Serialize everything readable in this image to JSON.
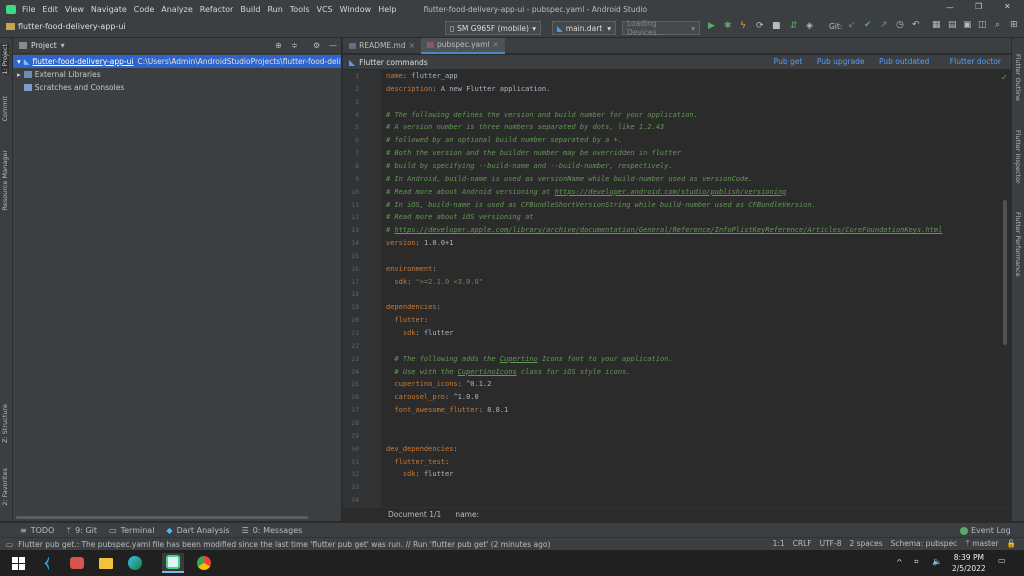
{
  "titlebar": {
    "menu": [
      "File",
      "Edit",
      "View",
      "Navigate",
      "Code",
      "Analyze",
      "Refactor",
      "Build",
      "Run",
      "Tools",
      "VCS",
      "Window",
      "Help"
    ],
    "window_title": "flutter-food-delivery-app-ui - pubspec.yaml - Android Studio"
  },
  "navbar": {
    "project_name": "flutter-food-delivery-app-ui",
    "device": "SM G965F (mobile)",
    "run_config": "main.dart",
    "loading": "Loading Devices...",
    "git_label": "Git:"
  },
  "left_stripe": [
    "1: Project",
    "Commit",
    "Resource Manager",
    "Z: Structure",
    "2: Favorites"
  ],
  "right_stripe": [
    "Flutter Outline",
    "Flutter Inspector",
    "Flutter Performance"
  ],
  "project_panel": {
    "title": "Project",
    "tree": [
      {
        "name": "flutter-food-delivery-app-ui",
        "path": "C:\\Users\\Admin\\AndroidStudioProjects\\flutter-food-delive"
      },
      {
        "name": "External Libraries",
        "path": ""
      },
      {
        "name": "Scratches and Consoles",
        "path": ""
      }
    ]
  },
  "editor_tabs": [
    {
      "label": "README.md"
    },
    {
      "label": "pubspec.yaml"
    }
  ],
  "flutter_commands": {
    "title": "Flutter commands",
    "actions": [
      "Pub get",
      "Pub upgrade",
      "Pub outdated",
      "Flutter doctor"
    ]
  },
  "code_lines": [
    [
      {
        "t": "name",
        "c": "k"
      },
      {
        "t": ": flutter_app",
        "c": "v"
      }
    ],
    [
      {
        "t": "description",
        "c": "k"
      },
      {
        "t": ": A new Flutter application.",
        "c": "v"
      }
    ],
    [],
    [
      {
        "t": "# The following defines the version and build number for your application.",
        "c": "c"
      }
    ],
    [
      {
        "t": "# A version number is three numbers separated by dots, like 1.2.43",
        "c": "c"
      }
    ],
    [
      {
        "t": "# followed by an optional build number separated by a +.",
        "c": "c"
      }
    ],
    [
      {
        "t": "# Both the version and the builder number may be overridden in flutter",
        "c": "c"
      }
    ],
    [
      {
        "t": "# build by specifying --build-name and --build-number, respectively.",
        "c": "c"
      }
    ],
    [
      {
        "t": "# In Android, build-name is used as versionName while build-number used as versionCode.",
        "c": "c"
      }
    ],
    [
      {
        "t": "# Read more about Android versioning at ",
        "c": "c"
      },
      {
        "t": "https://developer.android.com/studio/publish/versioning",
        "c": "cu"
      }
    ],
    [
      {
        "t": "# In iOS, build-name is used as CFBundleShortVersionString while build-number used as CFBundleVersion.",
        "c": "c"
      }
    ],
    [
      {
        "t": "# Read more about iOS versioning at",
        "c": "c"
      }
    ],
    [
      {
        "t": "# ",
        "c": "c"
      },
      {
        "t": "https://developer.apple.com/library/archive/documentation/General/Reference/InfoPlistKeyReference/Articles/CoreFoundationKeys.html",
        "c": "cu"
      }
    ],
    [
      {
        "t": "version",
        "c": "k"
      },
      {
        "t": ": 1.0.0+1",
        "c": "v"
      }
    ],
    [],
    [
      {
        "t": "environment",
        "c": "k"
      },
      {
        "t": ":",
        "c": "v"
      }
    ],
    [
      {
        "t": "  sdk",
        "c": "k"
      },
      {
        "t": ": ",
        "c": "v"
      },
      {
        "t": "\">=2.1.0 <3.0.0\"",
        "c": "s"
      }
    ],
    [],
    [
      {
        "t": "dependencies",
        "c": "k"
      },
      {
        "t": ":",
        "c": "v"
      }
    ],
    [
      {
        "t": "  flutter",
        "c": "k"
      },
      {
        "t": ":",
        "c": "v"
      }
    ],
    [
      {
        "t": "    sdk",
        "c": "k"
      },
      {
        "t": ": flutter",
        "c": "v"
      }
    ],
    [],
    [
      {
        "t": "  # The following adds the ",
        "c": "c"
      },
      {
        "t": "Cupertino",
        "c": "cu"
      },
      {
        "t": " Icons font to your application.",
        "c": "c"
      }
    ],
    [
      {
        "t": "  # Use with the ",
        "c": "c"
      },
      {
        "t": "CupertinoIcons",
        "c": "cu"
      },
      {
        "t": " class for iOS style icons.",
        "c": "c"
      }
    ],
    [
      {
        "t": "  cupertino_icons",
        "c": "k"
      },
      {
        "t": ": ^0.1.2",
        "c": "v"
      }
    ],
    [
      {
        "t": "  carousel_pro",
        "c": "k"
      },
      {
        "t": ": ^1.0.0",
        "c": "v"
      }
    ],
    [
      {
        "t": "  font_awesome_flutter",
        "c": "k"
      },
      {
        "t": ": 8.8.1",
        "c": "v"
      }
    ],
    [],
    [],
    [
      {
        "t": "dev_dependencies",
        "c": "k"
      },
      {
        "t": ":",
        "c": "v"
      }
    ],
    [
      {
        "t": "  flutter_test",
        "c": "k"
      },
      {
        "t": ":",
        "c": "v"
      }
    ],
    [
      {
        "t": "    sdk",
        "c": "k"
      },
      {
        "t": ": flutter",
        "c": "v"
      }
    ],
    [],
    []
  ],
  "breadcrumb": {
    "doc": "Document 1/1",
    "item": "name:"
  },
  "tool_windows": [
    "TODO",
    "9: Git",
    "Terminal",
    "Dart Analysis",
    "0: Messages"
  ],
  "event_log": "Event Log",
  "status": {
    "message": "Flutter pub get.: The pubspec.yaml file has been modified since the last time 'flutter pub get' was run. // Run 'flutter pub get' (2 minutes ago)",
    "position": "1:1",
    "line_sep": "CRLF",
    "encoding": "UTF-8",
    "indent": "2 spaces",
    "schema": "Schema: pubspec",
    "branch": "master"
  },
  "taskbar": {
    "time": "8:39 PM",
    "date": "2/5/2022"
  },
  "colors": {
    "accent": "#2f65ca",
    "link": "#589df6"
  }
}
